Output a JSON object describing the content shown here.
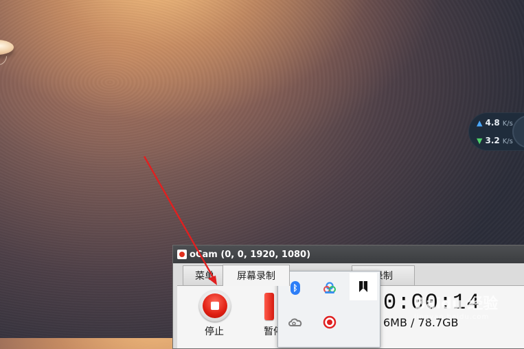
{
  "network_widget": {
    "upload_value": "4.8",
    "upload_unit": "K/s",
    "download_value": "3.2",
    "download_unit": "K/s"
  },
  "ocam": {
    "title": "oCam (0, 0, 1920, 1080)",
    "tabs": [
      {
        "label": "菜单"
      },
      {
        "label": "屏幕录制"
      },
      {
        "label": "录制"
      }
    ],
    "stop_label": "停止",
    "pause_label": "暂停",
    "timer": "0:00:14",
    "disk_usage": "6MB / 78.7GB"
  },
  "tray_popup": {
    "icons": [
      "bluetooth-icon",
      "cloud-sync-icon",
      "bookmark-icon",
      "creative-cloud-icon",
      "ocam-record-icon"
    ]
  },
  "colors": {
    "record_red": "#e01f12",
    "annotation_red": "#e02020",
    "titlebar": "#3b3d40"
  }
}
